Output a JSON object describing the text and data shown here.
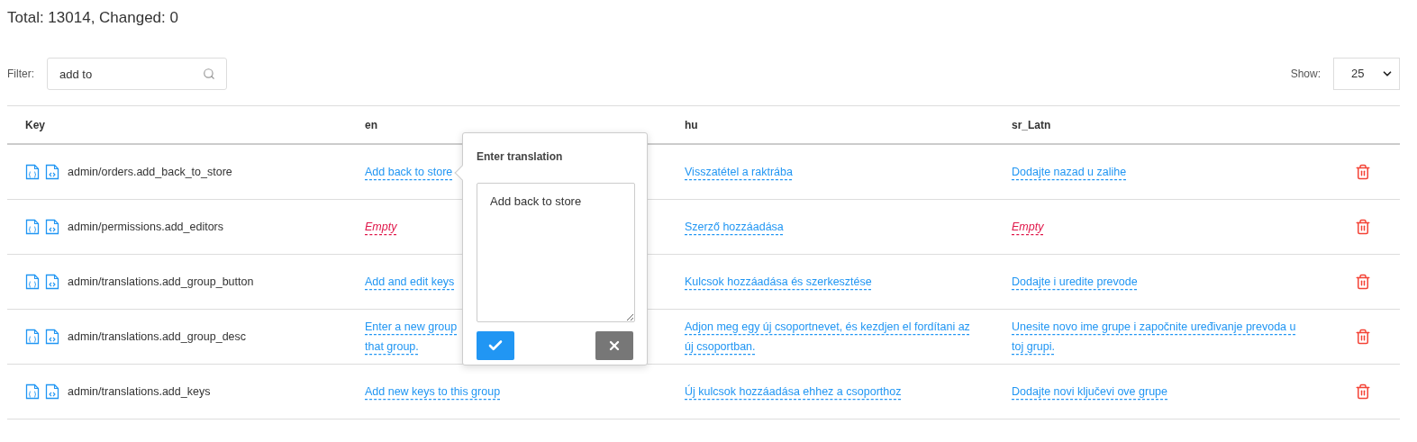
{
  "summary": "Total: 13014, Changed: 0",
  "filter": {
    "label": "Filter:",
    "value": "add to"
  },
  "show": {
    "label": "Show:",
    "value": "25"
  },
  "table": {
    "columns": [
      "Key",
      "en",
      "hu",
      "sr_Latn"
    ],
    "rows": [
      {
        "key": "admin/orders.add_back_to_store",
        "translations": [
          {
            "text": "Add back to store",
            "empty": false
          },
          {
            "text": "Visszatétel a raktrába",
            "empty": false
          },
          {
            "text": "Dodajte nazad u zalihe",
            "empty": false
          }
        ]
      },
      {
        "key": "admin/permissions.add_editors",
        "translations": [
          {
            "text": "Empty",
            "empty": true
          },
          {
            "text": "Szerző hozzáadása",
            "empty": false
          },
          {
            "text": "Empty",
            "empty": true
          }
        ]
      },
      {
        "key": "admin/translations.add_group_button",
        "translations": [
          {
            "text": "Add and edit keys",
            "empty": false
          },
          {
            "text": "Kulcsok hozzáadása és szerkesztése",
            "empty": false
          },
          {
            "text": "Dodajte i uredite prevode",
            "empty": false
          }
        ]
      },
      {
        "key": "admin/translations.add_group_desc",
        "translations": [
          {
            "lines": [
              "Enter a new group",
              "that group."
            ],
            "empty": false
          },
          {
            "text": "Adjon meg egy új csoportnevet, és kezdjen el fordítani az új csoportban.",
            "empty": false
          },
          {
            "text": "Unesite novo ime grupe i započnite uređivanje prevoda u toj grupi.",
            "empty": false
          }
        ]
      },
      {
        "key": "admin/translations.add_keys",
        "translations": [
          {
            "text": "Add new keys to this group",
            "empty": false
          },
          {
            "text": "Új kulcsok hozzáadása ehhez a csoporthoz",
            "empty": false
          },
          {
            "text": "Dodajte novi ključevi ove grupe",
            "empty": false
          }
        ]
      }
    ]
  },
  "popover": {
    "title": "Enter translation",
    "value": "Add back to store"
  }
}
